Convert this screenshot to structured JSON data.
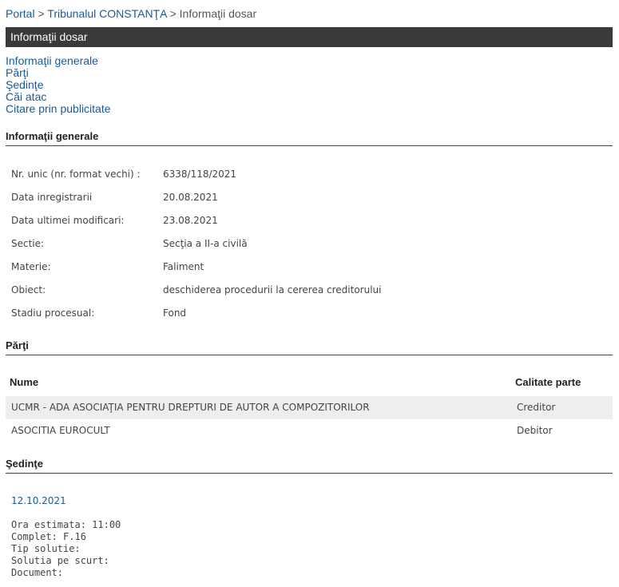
{
  "breadcrumb": {
    "portal": "Portal",
    "sep1": ">",
    "court": "Tribunalul CONSTANŢA",
    "sep2": ">",
    "current": "Informaţii dosar"
  },
  "title": "Informaţii dosar",
  "nav": [
    "Informaţii generale",
    "Părţi",
    "Şedinţe",
    "Căi atac",
    "Citare prin publicitate"
  ],
  "general": {
    "heading": "Informaţii generale",
    "rows": [
      {
        "label": "Nr. unic (nr. format vechi) :",
        "value": "6338/118/2021"
      },
      {
        "label": "Data inregistrarii",
        "value": "20.08.2021"
      },
      {
        "label": "Data ultimei modificari:",
        "value": "23.08.2021"
      },
      {
        "label": "Sectie:",
        "value": "Secţia a II-a civilă"
      },
      {
        "label": "Materie:",
        "value": "Faliment"
      },
      {
        "label": "Obiect:",
        "value": "deschiderea procedurii la cererea creditorului"
      },
      {
        "label": "Stadiu procesual:",
        "value": "Fond"
      }
    ]
  },
  "parti": {
    "heading": "Părţi",
    "col_name": "Nume",
    "col_role": "Calitate parte",
    "rows": [
      {
        "name": "UCMR - ADA ASOCIAŢIA PENTRU DREPTURI DE AUTOR A COMPOZITORILOR",
        "role": "Creditor"
      },
      {
        "name": "ASOCITIA EUROCULT",
        "role": "Debitor"
      }
    ]
  },
  "sedinte": {
    "heading": "Şedinţe",
    "date": "12.10.2021",
    "details": [
      "Ora estimata: 11:00",
      "Complet: F.16",
      "Tip solutie:",
      "Solutia pe scurt:",
      "Document:"
    ]
  },
  "colors": {
    "link": "#1a5a96",
    "titlebar": "#3a3a3a",
    "alt_row": "#eeeeee"
  }
}
